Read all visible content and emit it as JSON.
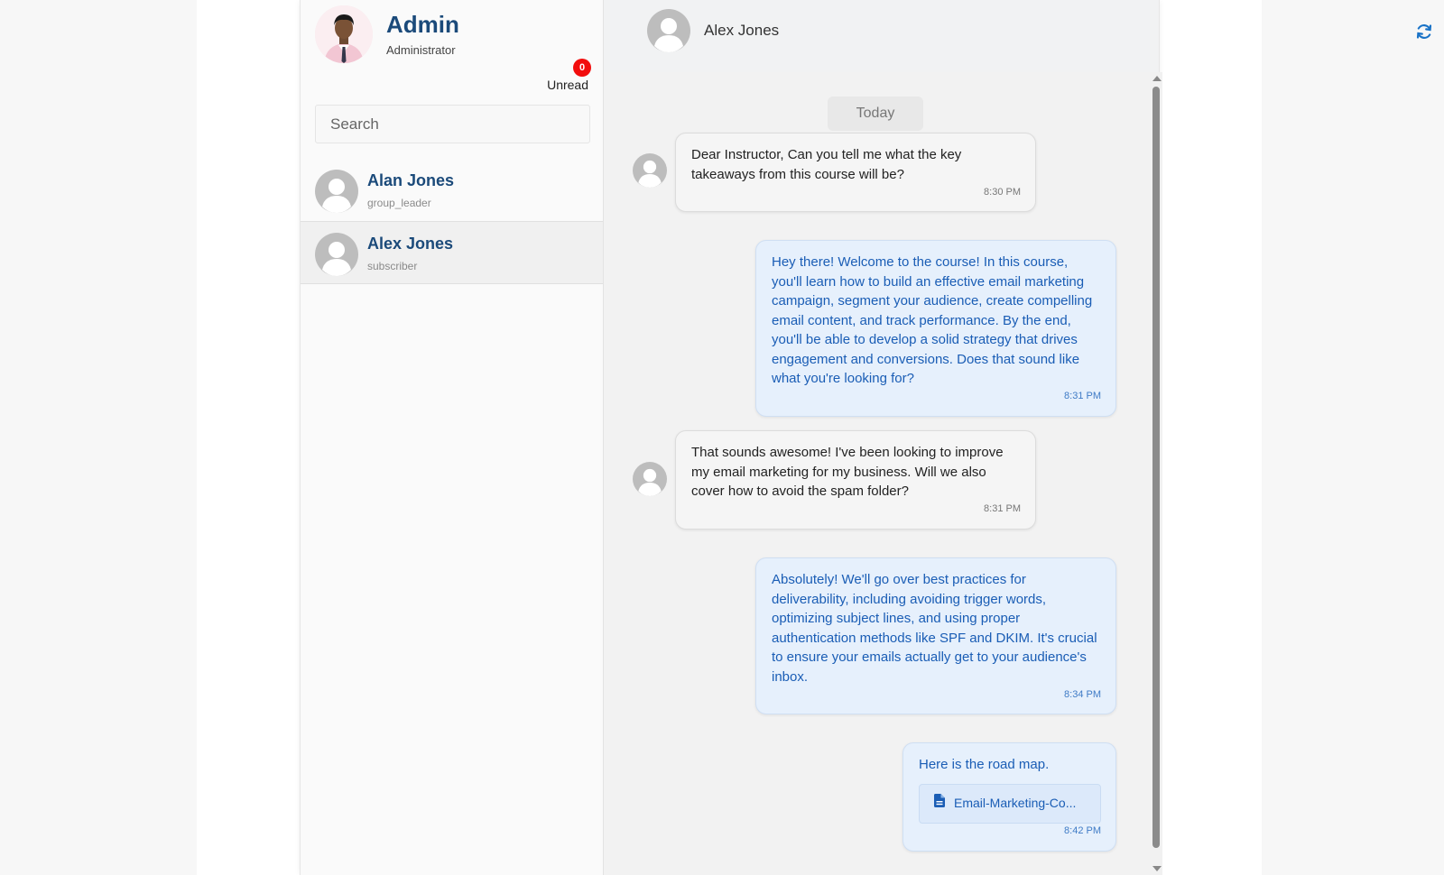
{
  "admin": {
    "name": "Admin",
    "role": "Administrator",
    "unread_count": "0",
    "unread_label": "Unread"
  },
  "search": {
    "placeholder": "Search"
  },
  "contacts": [
    {
      "name": "Alan Jones",
      "role": "group_leader"
    },
    {
      "name": "Alex Jones",
      "role": "subscriber"
    }
  ],
  "chat": {
    "title": "Alex Jones",
    "day_label": "Today",
    "messages": [
      {
        "direction": "in",
        "text": "Dear Instructor, Can you tell me what the key takeaways from this course will be?",
        "time": "8:30 PM"
      },
      {
        "direction": "out",
        "text": "Hey there! Welcome to the course! In this course, you'll learn how to build an effective email marketing campaign, segment your audience, create compelling email content, and track performance. By the end, you'll be able to develop a solid strategy that drives engagement and conversions. Does that sound like what you're looking for?",
        "time": "8:31 PM"
      },
      {
        "direction": "in",
        "text": "That sounds awesome! I've been looking to improve my email marketing for my business. Will we also cover how to avoid the spam folder?",
        "time": "8:31 PM"
      },
      {
        "direction": "out",
        "text": "Absolutely! We'll go over best practices for deliverability, including avoiding trigger words, optimizing subject lines, and using proper authentication methods like SPF and DKIM. It's crucial to ensure your emails actually get to your audience's inbox.",
        "time": "8:34 PM"
      },
      {
        "direction": "out",
        "text": "Here is the road map.",
        "time": "8:42 PM",
        "attachment": "Email-Marketing-Co..."
      }
    ]
  },
  "icons": {
    "refresh": "refresh-icon",
    "file": "file-icon",
    "avatar": "user-avatar-icon"
  },
  "colors": {
    "brand_blue": "#1b4a7a",
    "accent_blue": "#1a5db5",
    "badge_red": "#f20d0d",
    "out_bubble": "#e6f0fc"
  }
}
